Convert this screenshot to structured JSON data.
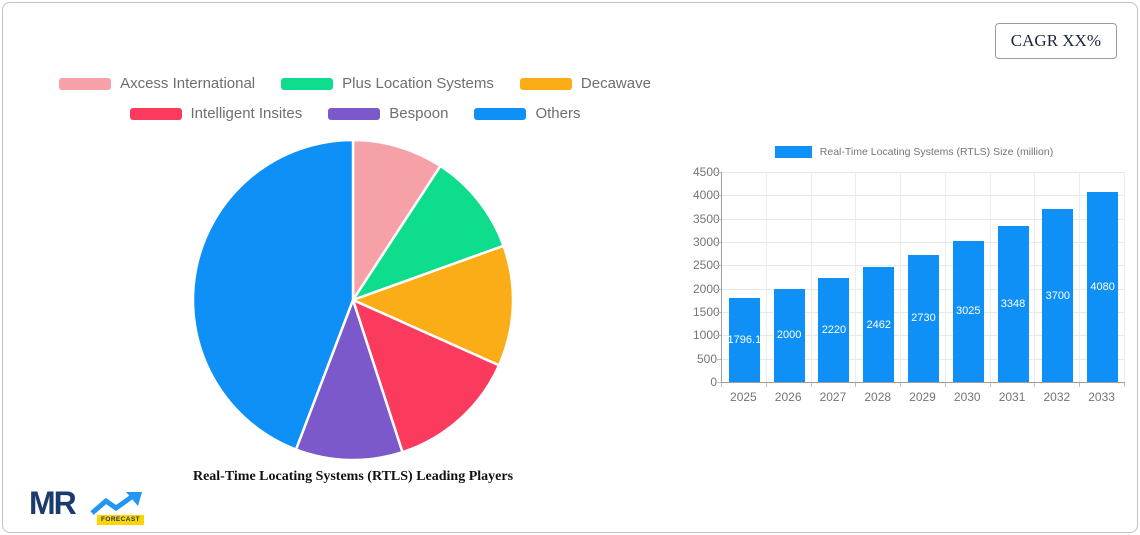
{
  "cagr_badge": {
    "label": "CAGR XX%"
  },
  "logo": {
    "mr": "MR",
    "forecast": "FORECAST"
  },
  "colors": {
    "bar_blue": "#0E90F7",
    "legend_text": "#6E6E6E",
    "axis_text": "#757575",
    "gridline": "#E8E8E8",
    "card_border": "#C2C2C2",
    "cagr_text": "#1A2639",
    "logo_navy": "#1B3A70",
    "logo_blue": "#2196F3",
    "logo_yellow": "#FFD500"
  },
  "chart_data": [
    {
      "type": "pie",
      "title": "Real-Time Locating Systems (RTLS) Leading Players",
      "slices": [
        {
          "label": "Axcess International",
          "color": "#F5A1A7",
          "value": 9.2
        },
        {
          "label": "Plus Location Systems",
          "color": "#0FDD8E",
          "value": 10.3
        },
        {
          "label": "Decawave",
          "color": "#FBAD18",
          "value": 12.2
        },
        {
          "label": "Intelligent Insites",
          "color": "#FB3B5E",
          "value": 13.3
        },
        {
          "label": "Bespoon",
          "color": "#7C59CB",
          "value": 10.8
        },
        {
          "label": "Others",
          "color": "#0E90F7",
          "value": 44.2
        }
      ],
      "values_note": "percent share, estimated from slice angles (no data labels shown)",
      "start_angle_deg": 0,
      "direction": "clockwise",
      "legend_position": "top"
    },
    {
      "type": "bar",
      "title": "Real-Time Locating Systems (RTLS) Size (million)",
      "categories": [
        "2025",
        "2026",
        "2027",
        "2028",
        "2029",
        "2030",
        "2031",
        "2032",
        "2033"
      ],
      "values": [
        1796.1,
        2000,
        2220,
        2462,
        2730,
        3025,
        3348,
        3700,
        4080
      ],
      "bar_color": "#0E90F7",
      "ylim": [
        0,
        4500
      ],
      "ytick_step": 500,
      "grid": true,
      "value_labels": "inside bars, white, centered",
      "legend_position": "top"
    }
  ]
}
